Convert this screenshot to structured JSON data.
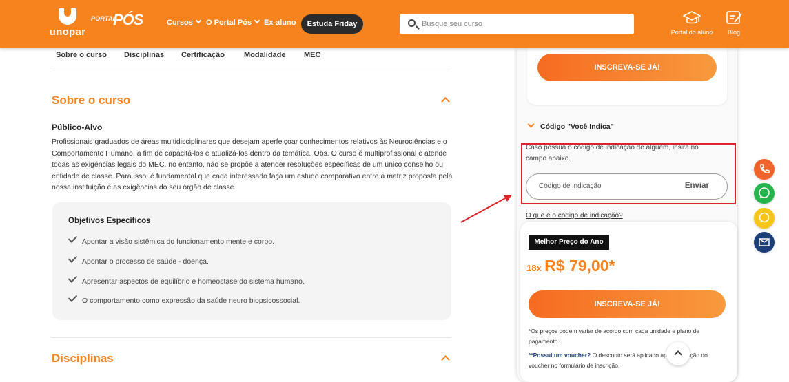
{
  "header": {
    "logo_word": "unopar",
    "portal_text": "PORTAL",
    "pos_text": "PÓS",
    "nav": [
      {
        "label": "Cursos"
      },
      {
        "label": "O Portal Pós"
      },
      {
        "label": "Ex-aluno"
      }
    ],
    "cta": "Estuda Friday",
    "search_placeholder": "Busque seu curso",
    "icons": [
      {
        "label": "Portal do aluno",
        "icon": "graduation-cap-icon"
      },
      {
        "label": "Blog",
        "icon": "blog-icon"
      }
    ],
    "brand_color": "#f7831f"
  },
  "tabs": [
    "Sobre o curso",
    "Disciplinas",
    "Certificação",
    "Modalidade",
    "MEC"
  ],
  "about": {
    "title": "Sobre o curso",
    "audience_heading": "Público-Alvo",
    "audience_text": "Profissionais graduados de áreas multidisciplinares que desejam aperfeiçoar conhecimentos relativos às Neurociências e o Comportamento Humano, a fim de capacitá-los e atualizá-los dentro da temática. Obs. O curso é multiprofissional e atende todas as exigências legais do MEC, no entanto, não se propõe a atender resoluções específicas de um único conselho ou entidade de classe. Para isso, é fundamental que cada interessado faça um estudo comparativo entre a matriz proposta pela nossa instituição e as exigências do seu órgão de classe.",
    "objectives_heading": "Objetivos Específicos",
    "objectives": [
      "Apontar a visão sistêmica do funcionamento mente e corpo.",
      "Apontar o processo de saúde - doença.",
      "Apresentar aspectos de equilíbrio e homeostase do sistema humano.",
      "O comportamento como expressão da saúde neuro biopsicossocial."
    ]
  },
  "disciplines": {
    "title": "Disciplinas"
  },
  "sidebar": {
    "enroll_top": "INSCREVA-SE JÁ!",
    "referral_heading": "Código \"Você Indica\"",
    "referral_text": "Caso possua o código de indicação de alguém, insira no campo abaixo.",
    "referral_placeholder": "Código de indicação",
    "referral_send": "Enviar",
    "referral_link": "O que é o código de indicação?",
    "badge": "Melhor Preço do Ano",
    "installments": "18x",
    "price": "R$ 79,00*",
    "enroll_bottom": "INSCREVA-SE JÁ!",
    "note_prices": "*Os preços podem variar de acordo com cada unidade e plano de pagamento.",
    "note_voucher_label": "**Possui um voucher?",
    "note_voucher_text": " O desconto será aplicado após validação do voucher no formulário de inscrição."
  },
  "floating": [
    {
      "icon": "phone-icon",
      "color": "#f0642b"
    },
    {
      "icon": "whatsapp-icon",
      "color": "#25b34b"
    },
    {
      "icon": "chat-icon",
      "color": "#f5c518"
    },
    {
      "icon": "mail-icon",
      "color": "#1c3f78"
    }
  ],
  "annotation_color": "#e0222a"
}
